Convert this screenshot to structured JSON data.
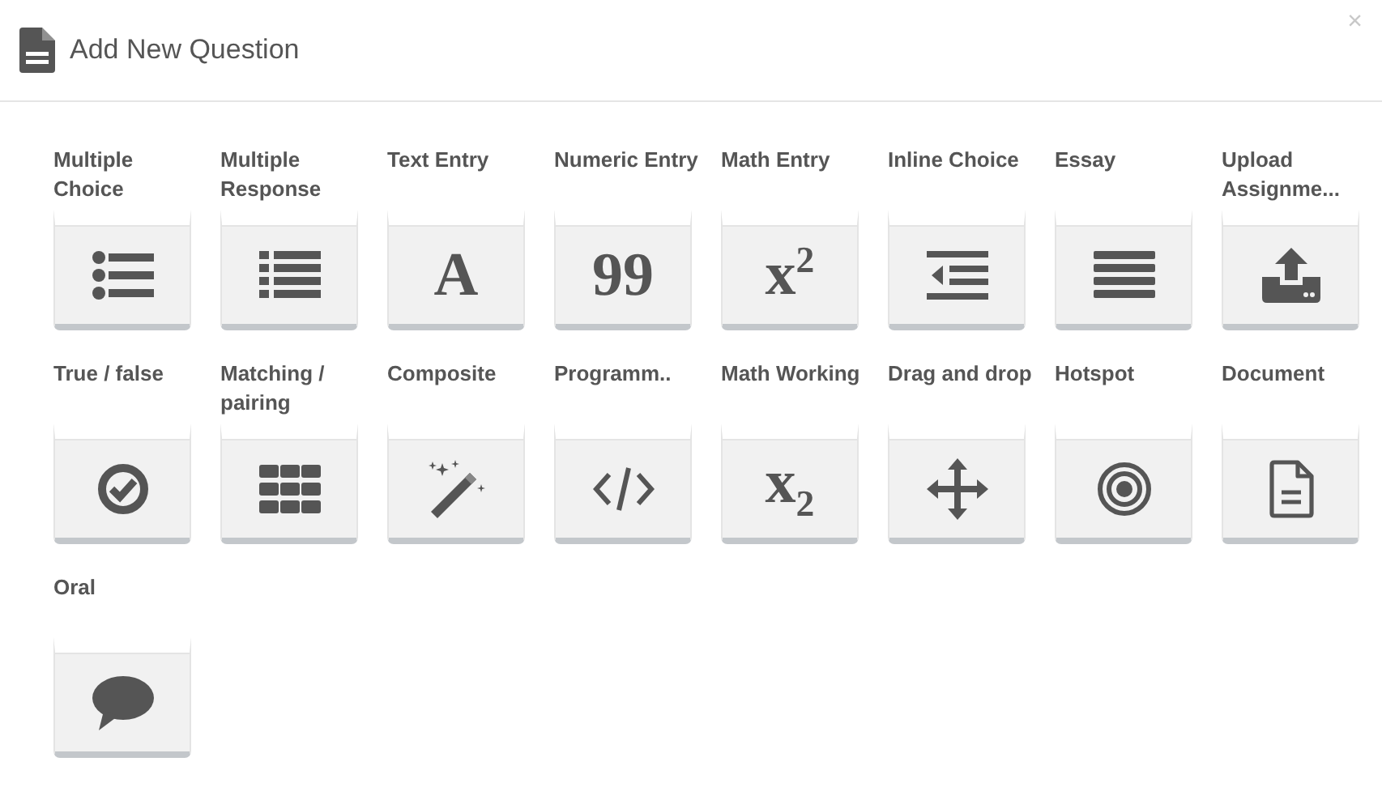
{
  "dialog": {
    "title": "Add New Question",
    "close": "×"
  },
  "question_types": [
    {
      "label": "Multiple Choice",
      "kind": "bullet-list"
    },
    {
      "label": "Multiple Response",
      "kind": "square-list"
    },
    {
      "label": "Text Entry",
      "kind": "glyph",
      "glyph": "A"
    },
    {
      "label": "Numeric Entry",
      "kind": "glyph",
      "glyph": "99"
    },
    {
      "label": "Math Entry",
      "kind": "glyph",
      "glyph": "x$^{2}$"
    },
    {
      "label": "Inline Choice",
      "kind": "outdent"
    },
    {
      "label": "Essay",
      "kind": "lines"
    },
    {
      "label": "Upload Assignme...",
      "kind": "upload"
    },
    {
      "label": "True / false",
      "kind": "check"
    },
    {
      "label": "Matching / pairing",
      "kind": "grid"
    },
    {
      "label": "Composite",
      "kind": "wand"
    },
    {
      "label": "Programm..",
      "kind": "code"
    },
    {
      "label": "Math Working",
      "kind": "glyph",
      "glyph": "x$_{2}$"
    },
    {
      "label": "Drag and drop",
      "kind": "move"
    },
    {
      "label": "Hotspot",
      "kind": "target"
    },
    {
      "label": "Document",
      "kind": "document"
    },
    {
      "label": "Oral",
      "kind": "speech"
    }
  ]
}
